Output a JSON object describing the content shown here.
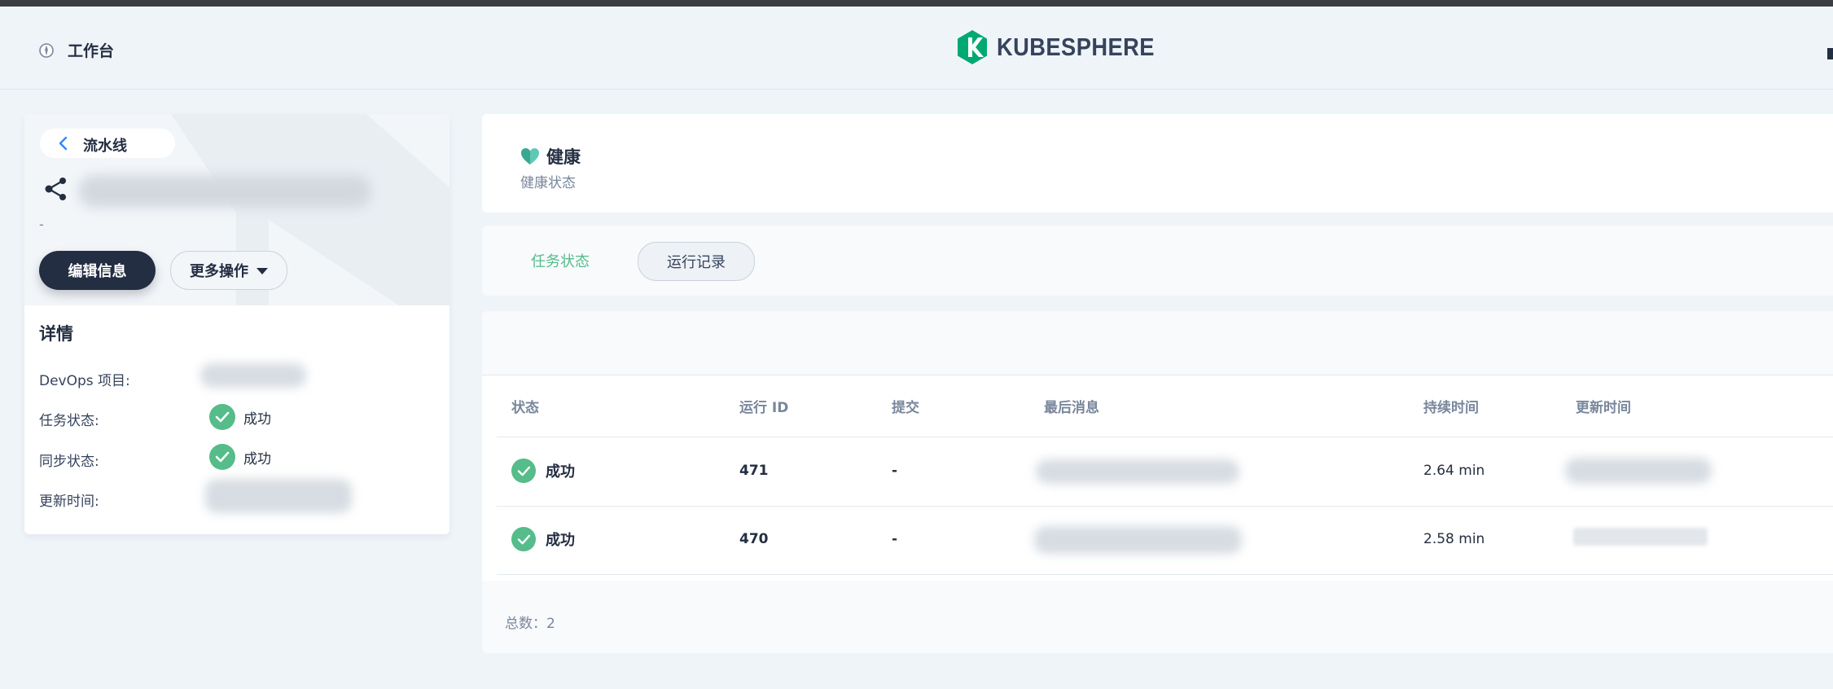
{
  "header": {
    "workbench_label": "工作台",
    "logo_text": "KUBESPHERE",
    "brand_color": "#00a971"
  },
  "sidebar": {
    "back_label": "流水线",
    "description": "-",
    "edit_button": "编辑信息",
    "more_button": "更多操作",
    "details_title": "详情",
    "details": [
      {
        "label": "DevOps 项目:",
        "value": ""
      },
      {
        "label": "任务状态:",
        "value": "成功"
      },
      {
        "label": "同步状态:",
        "value": "成功"
      },
      {
        "label": "更新时间:",
        "value": ""
      }
    ]
  },
  "health": {
    "title": "健康",
    "subtitle": "健康状态"
  },
  "tabs": [
    {
      "label": "任务状态",
      "active": false
    },
    {
      "label": "运行记录",
      "active": true
    }
  ],
  "table": {
    "columns": [
      "状态",
      "运行 ID",
      "提交",
      "最后消息",
      "持续时间",
      "更新时间"
    ],
    "rows": [
      {
        "status": "成功",
        "run_id": "471",
        "commit": "-",
        "message": "",
        "duration": "2.64 min",
        "updated": ""
      },
      {
        "status": "成功",
        "run_id": "470",
        "commit": "-",
        "message": "",
        "duration": "2.58 min",
        "updated": ""
      }
    ],
    "total_label": "总数：2"
  },
  "colors": {
    "success": "#55bc8a",
    "dark": "#242e42",
    "page_bg": "#eff4f9"
  }
}
